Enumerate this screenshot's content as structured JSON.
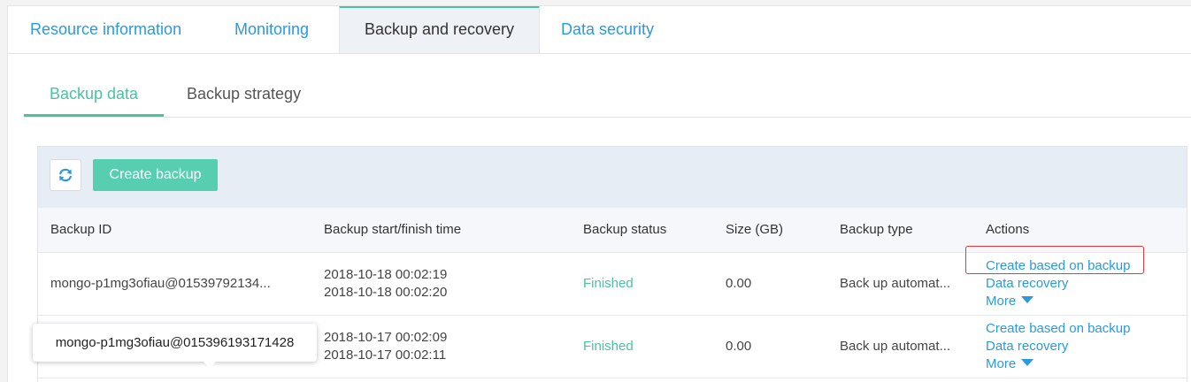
{
  "tabs": [
    {
      "label": "Resource information",
      "active": false
    },
    {
      "label": "Monitoring",
      "active": false
    },
    {
      "label": "Backup and recovery",
      "active": true
    },
    {
      "label": "Data security",
      "active": false
    }
  ],
  "subtabs": [
    {
      "label": "Backup data",
      "active": true
    },
    {
      "label": "Backup strategy",
      "active": false
    }
  ],
  "toolbar": {
    "refresh_icon": "refresh-icon",
    "create_label": "Create backup"
  },
  "table": {
    "columns": [
      "Backup ID",
      "Backup start/finish time",
      "Backup status",
      "Size (GB)",
      "Backup type",
      "Actions"
    ],
    "rows": [
      {
        "id": "mongo-p1mg3ofiau@01539792134...",
        "start": "2018-10-18 00:02:19",
        "finish": "2018-10-18 00:02:20",
        "status": "Finished",
        "size": "0.00",
        "type": "Back up automat...",
        "actions": [
          "Create based on backup",
          "Data recovery",
          "More"
        ]
      },
      {
        "id": "",
        "start": "2018-10-17 00:02:09",
        "finish": "2018-10-17 00:02:11",
        "status": "Finished",
        "size": "0.00",
        "type": "Back up automat...",
        "actions": [
          "Create based on backup",
          "Data recovery",
          "More"
        ]
      }
    ]
  },
  "tooltip": {
    "text": "mongo-p1mg3ofiau@015396193171428"
  },
  "colors": {
    "accent": "#4bc1a6",
    "link": "#2a9ae0",
    "highlight": "#e03a3a"
  }
}
